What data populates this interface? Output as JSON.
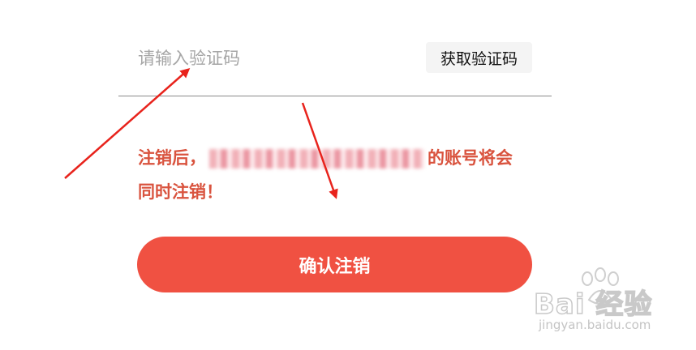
{
  "verification": {
    "code_placeholder": "请输入验证码",
    "code_value": "",
    "get_code_label": "获取验证码"
  },
  "warning": {
    "line1_prefix": "注销后，",
    "line1_suffix": "的账号将会",
    "line2": "同时注销！",
    "color": "#d9533e"
  },
  "confirm": {
    "label": "确认注销",
    "color": "#f05142"
  },
  "watermark": {
    "brand": "Bai 经验",
    "url": "jingyan.baidu.com"
  },
  "annotation": {
    "arrow_color": "#e8231c"
  }
}
